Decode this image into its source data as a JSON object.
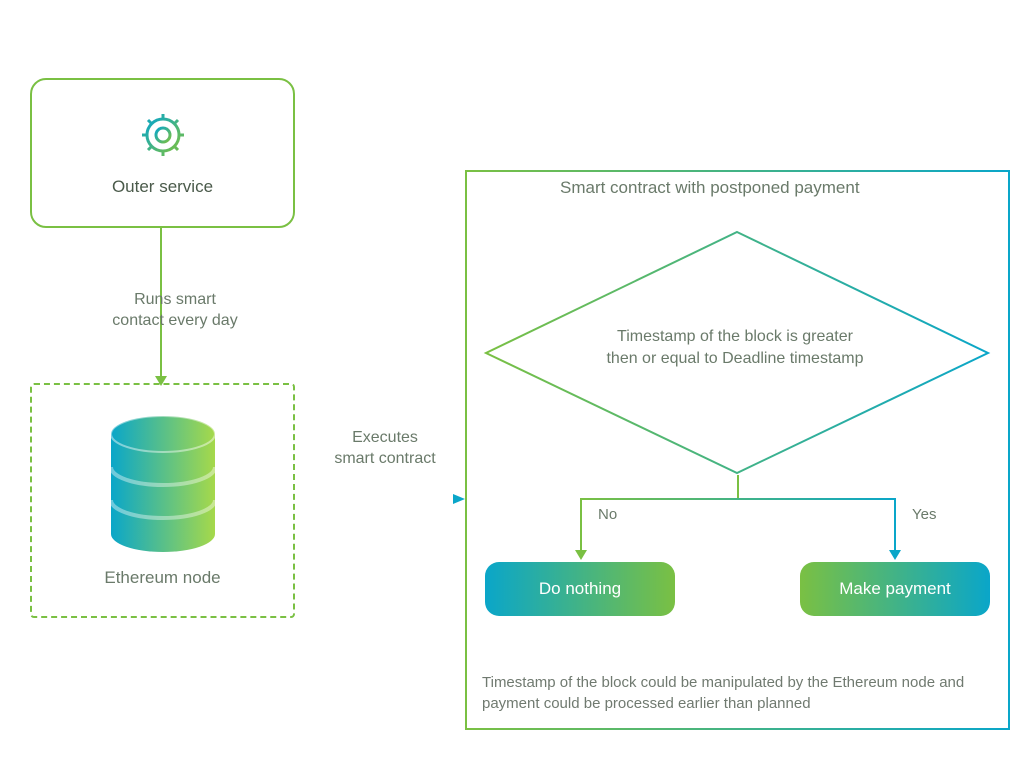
{
  "outer_service": {
    "label": "Outer service",
    "icon": "gear-icon"
  },
  "arrows": {
    "runs_smart": "Runs smart\ncontact every day",
    "executes": "Executes\nsmart contract"
  },
  "ethereum_node": {
    "label": "Ethereum node",
    "icon": "database-cylinder"
  },
  "smart_contract": {
    "title": "Smart contract with postponed payment",
    "decision_text": "Timestamp of the block is greater\nthen or equal to Deadline timestamp",
    "no_label": "No",
    "yes_label": "Yes",
    "do_nothing": "Do nothing",
    "make_payment": "Make payment",
    "footnote": "Timestamp of the block could be manipulated by the Ethereum node and payment could be  processed earlier than planned"
  },
  "colors": {
    "green": "#7ac043",
    "teal": "#0aa6c9",
    "text": "#6a7a6a"
  }
}
